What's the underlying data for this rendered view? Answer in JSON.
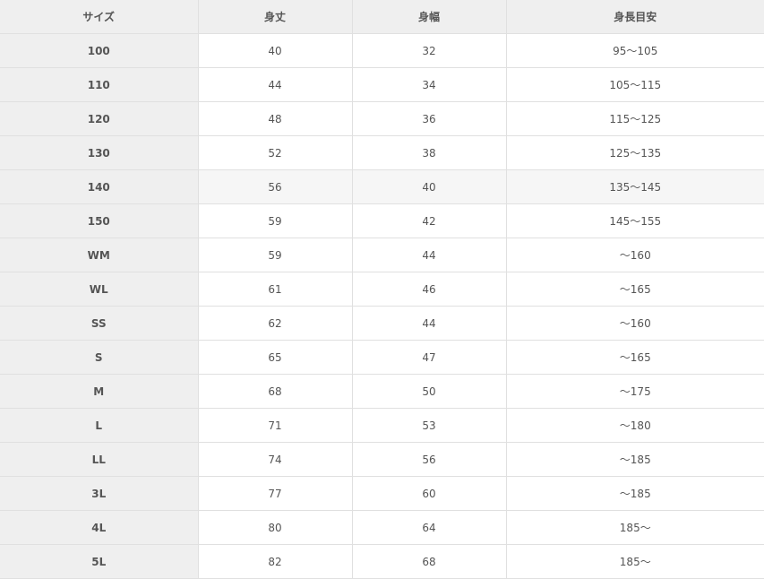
{
  "headers": {
    "size": "サイズ",
    "length": "身丈",
    "width": "身幅",
    "height": "身長目安"
  },
  "rows": [
    {
      "size": "100",
      "length": "40",
      "width": "32",
      "height": "95〜105"
    },
    {
      "size": "110",
      "length": "44",
      "width": "34",
      "height": "105〜115"
    },
    {
      "size": "120",
      "length": "48",
      "width": "36",
      "height": "115〜125"
    },
    {
      "size": "130",
      "length": "52",
      "width": "38",
      "height": "125〜135"
    },
    {
      "size": "140",
      "length": "56",
      "width": "40",
      "height": "135〜145"
    },
    {
      "size": "150",
      "length": "59",
      "width": "42",
      "height": "145〜155"
    },
    {
      "size": "WM",
      "length": "59",
      "width": "44",
      "height": "〜160"
    },
    {
      "size": "WL",
      "length": "61",
      "width": "46",
      "height": "〜165"
    },
    {
      "size": "SS",
      "length": "62",
      "width": "44",
      "height": "〜160"
    },
    {
      "size": "S",
      "length": "65",
      "width": "47",
      "height": "〜165"
    },
    {
      "size": "M",
      "length": "68",
      "width": "50",
      "height": "〜175"
    },
    {
      "size": "L",
      "length": "71",
      "width": "53",
      "height": "〜180"
    },
    {
      "size": "LL",
      "length": "74",
      "width": "56",
      "height": "〜185"
    },
    {
      "size": "3L",
      "length": "77",
      "width": "60",
      "height": "〜185"
    },
    {
      "size": "4L",
      "length": "80",
      "width": "64",
      "height": "185〜"
    },
    {
      "size": "5L",
      "length": "82",
      "width": "68",
      "height": "185〜"
    }
  ],
  "highlighted_row_index": 4
}
